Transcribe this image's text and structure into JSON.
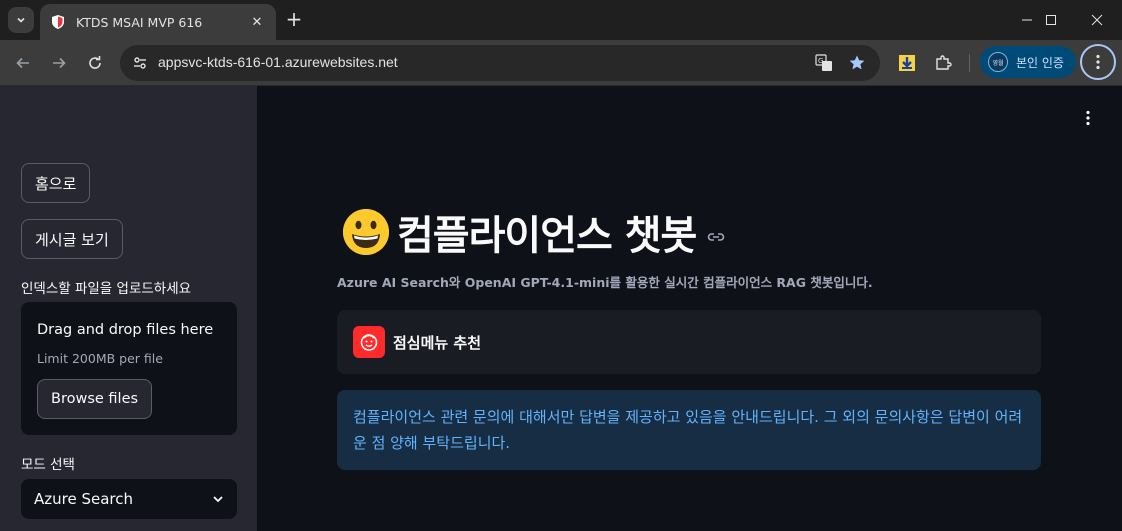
{
  "browser": {
    "tab": {
      "title": "KTDS MSAI MVP 616",
      "close_glyph": "✕"
    },
    "new_tab_glyph": "+",
    "window_controls": {
      "minimize": "minimize-icon",
      "maximize": "maximize-icon",
      "close": "close-icon"
    },
    "address": {
      "url": "appsvc-ktds-616-01.azurewebsites.net"
    },
    "profile": {
      "label": "본인 인증",
      "avatar_text": "영월"
    },
    "icons": [
      "back-icon",
      "forward-icon",
      "reload-icon",
      "site-info-icon",
      "translate-icon",
      "bookmark-star-icon",
      "extension-download-icon",
      "extensions-puzzle-icon",
      "chrome-menu-icon"
    ]
  },
  "sidebar": {
    "home_button": "홈으로",
    "posts_button": "게시글 보기",
    "upload_label": "인덱스할 파일을 업로드하세요",
    "uploader": {
      "title": "Drag and drop files here",
      "limit": "Limit 200MB per file",
      "browse_label": "Browse files"
    },
    "mode_label": "모드 선택",
    "mode_select": {
      "value": "Azure Search"
    }
  },
  "main": {
    "title": "컴플라이언스 챗봇",
    "caption": "Azure AI Search와 OpenAI GPT-4.1-mini를 활용한 실시간 컴플라이언스 RAG 챗봇입니다.",
    "expander_label": "점심메뉴 추천",
    "info_text": "컴플라이언스 관련 문의에 대해서만 답변을 제공하고 있음을 안내드립니다. 그 외의 문의사항은 답변이 어려운 점 양해 부탁드립니다."
  },
  "colors": {
    "accent_red": "#ff2b2b",
    "info_bg": "#172d43",
    "info_text": "#60b4ff",
    "sidebar_bg": "#262730",
    "main_bg": "#0e1117"
  }
}
